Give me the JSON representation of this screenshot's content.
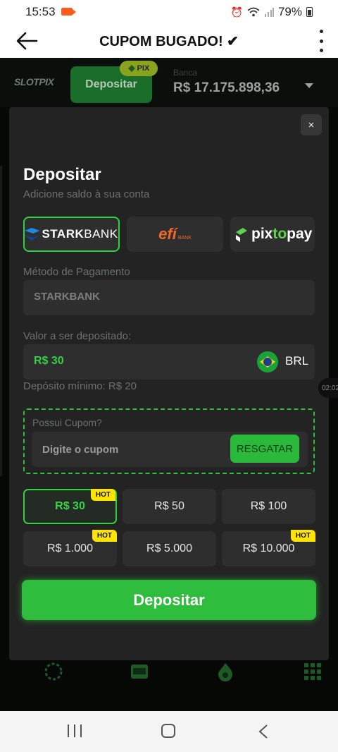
{
  "status_bar": {
    "time": "15:53",
    "battery": "79%"
  },
  "app_bar": {
    "title": "CUPOM BUGADO! ✔"
  },
  "casino_header": {
    "logo": "SLOTPIX",
    "deposit_label": "Depositar",
    "pix_badge": "PIX",
    "banca_label": "Banca",
    "balance": "R$ 17.175.898,36"
  },
  "modal": {
    "close_label": "×",
    "title": "Depositar",
    "subtitle": "Adicione saldo à sua conta",
    "providers": [
      {
        "name": "STARKBANK",
        "part1": "STARK",
        "part2": "BANK",
        "selected": true
      },
      {
        "name": "efí BANK",
        "main": "efí",
        "suffix": "BANK",
        "selected": false
      },
      {
        "name": "pixtopay",
        "part1": "pix",
        "part2": "to",
        "part3": "pay",
        "selected": false
      }
    ],
    "method_label": "Método de Pagamento",
    "method_value": "STARKBANK",
    "amount_label": "Valor a ser depositado:",
    "amount_value": "R$ 30",
    "currency": "BRL",
    "min_text": "Depósito mínimo: R$ 20",
    "coupon": {
      "label": "Possui Cupom?",
      "placeholder": "Digite o cupom",
      "button": "RESGATAR"
    },
    "amounts": [
      {
        "label": "R$ 30",
        "hot": true,
        "selected": true
      },
      {
        "label": "R$ 50",
        "hot": false,
        "selected": false
      },
      {
        "label": "R$ 100",
        "hot": false,
        "selected": false
      },
      {
        "label": "R$ 1.000",
        "hot": true,
        "selected": false
      },
      {
        "label": "R$ 5.000",
        "hot": false,
        "selected": false
      },
      {
        "label": "R$ 10.000",
        "hot": true,
        "selected": false
      }
    ],
    "hot_label": "HOT",
    "deposit_button": "Depositar"
  },
  "overlay": {
    "time_pill": "02:02"
  },
  "colors": {
    "accent": "#2ebd3c",
    "hot": "#ffe400",
    "modal_bg": "#222322",
    "field_bg": "#2d2e2d"
  }
}
